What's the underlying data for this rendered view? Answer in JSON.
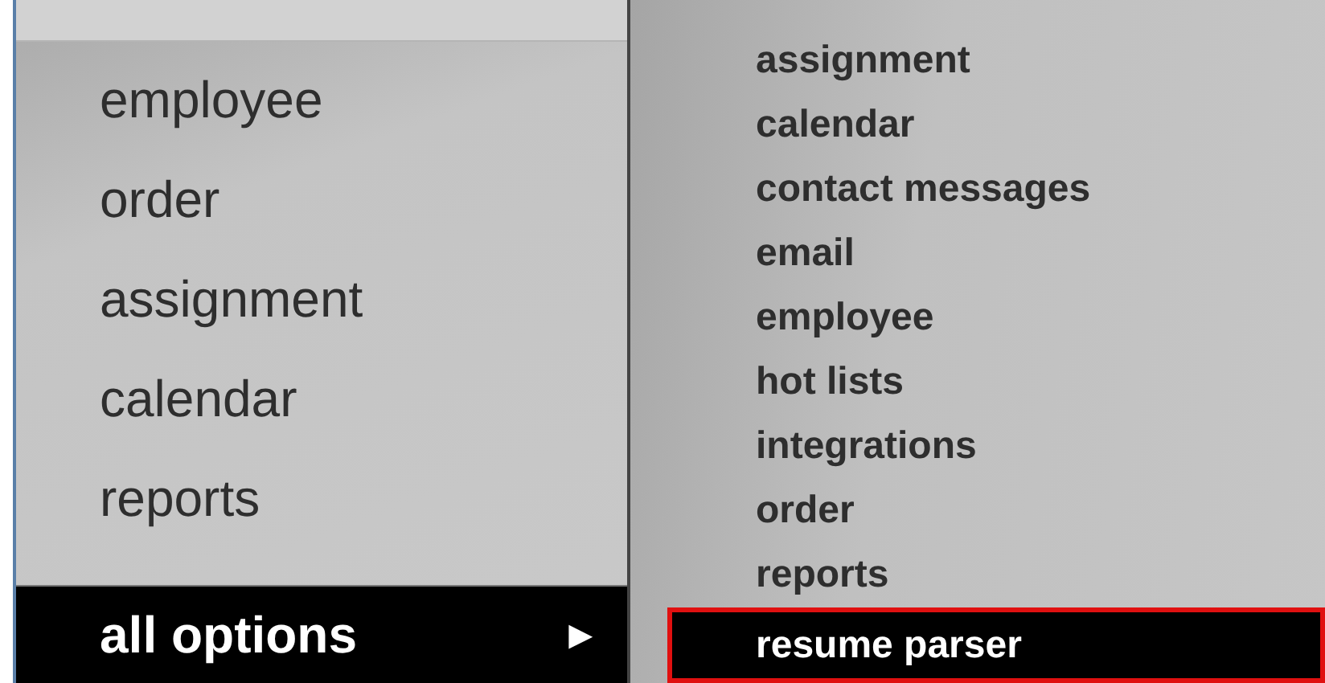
{
  "main_menu": {
    "items": [
      {
        "label": "employee",
        "selected": false
      },
      {
        "label": "order",
        "selected": false
      },
      {
        "label": "assignment",
        "selected": false
      },
      {
        "label": "calendar",
        "selected": false
      },
      {
        "label": "reports",
        "selected": false
      }
    ],
    "all_options": {
      "label": "all options",
      "arrow": "▶",
      "selected": true
    }
  },
  "submenu": {
    "items": [
      {
        "label": "assignment",
        "selected": false,
        "outlined": false
      },
      {
        "label": "calendar",
        "selected": false,
        "outlined": false
      },
      {
        "label": "contact messages",
        "selected": false,
        "outlined": false
      },
      {
        "label": "email",
        "selected": false,
        "outlined": false
      },
      {
        "label": "employee",
        "selected": false,
        "outlined": false
      },
      {
        "label": "hot lists",
        "selected": false,
        "outlined": false
      },
      {
        "label": "integrations",
        "selected": false,
        "outlined": false
      },
      {
        "label": "order",
        "selected": false,
        "outlined": false
      },
      {
        "label": "reports",
        "selected": false,
        "outlined": false
      },
      {
        "label": "resume parser",
        "selected": true,
        "outlined": true
      }
    ]
  }
}
